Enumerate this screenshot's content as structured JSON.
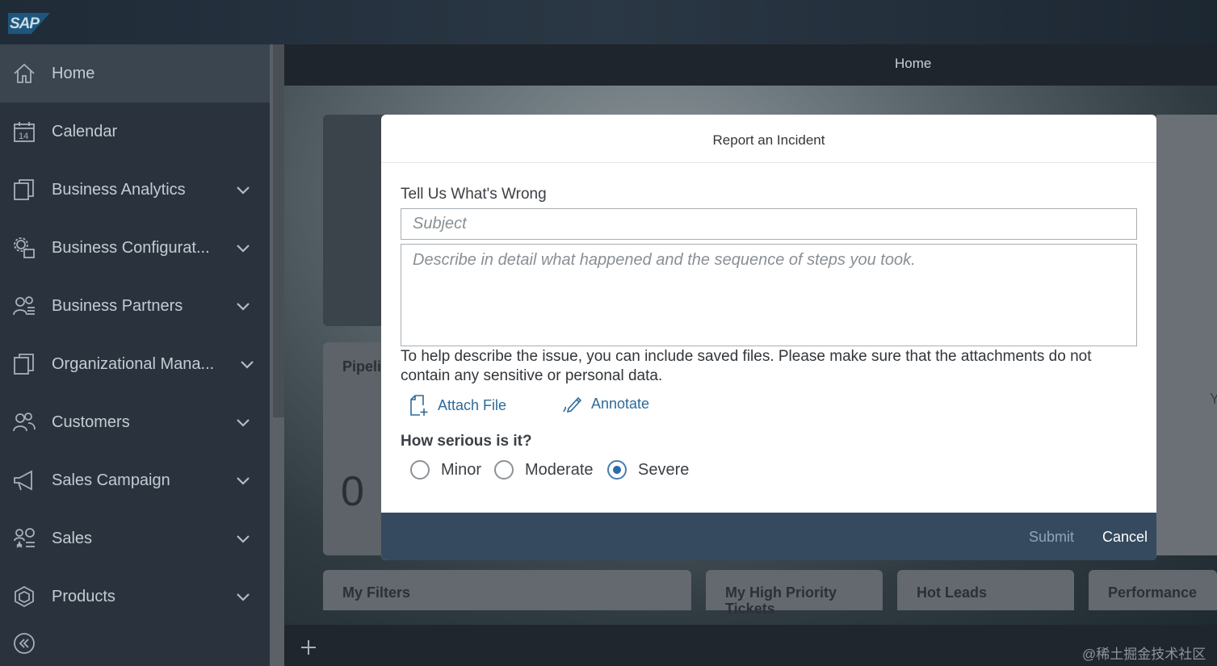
{
  "app": {
    "logo_text": "SAP",
    "shell_title": "Home"
  },
  "sidebar": {
    "items": [
      {
        "label": "Home",
        "icon": "home-icon",
        "active": true,
        "expandable": false
      },
      {
        "label": "Calendar",
        "icon": "calendar-icon",
        "expandable": false
      },
      {
        "label": "Business Analytics",
        "icon": "copy-icon",
        "expandable": true
      },
      {
        "label": "Business Configurat...",
        "icon": "settings-group-icon",
        "expandable": true
      },
      {
        "label": "Business Partners",
        "icon": "partners-icon",
        "expandable": true
      },
      {
        "label": "Organizational Mana...",
        "icon": "copy-icon",
        "expandable": true
      },
      {
        "label": "Customers",
        "icon": "customers-icon",
        "expandable": true
      },
      {
        "label": "Sales Campaign",
        "icon": "megaphone-icon",
        "expandable": true
      },
      {
        "label": "Sales",
        "icon": "sales-icon",
        "expandable": true
      },
      {
        "label": "Products",
        "icon": "product-icon",
        "expandable": true
      }
    ],
    "calendar_day": "14"
  },
  "background": {
    "pipeline_title": "Pipeli",
    "pipeline_value": "0",
    "right_fragment": "Y",
    "tiles": [
      "My Filters",
      "My High Priority Tickets",
      "Hot Leads",
      "Performance"
    ]
  },
  "dialog": {
    "title": "Report an Incident",
    "field_label": "Tell Us What's Wrong",
    "subject_placeholder": "Subject",
    "description_placeholder": "Describe in detail what happened and the sequence of steps you took.",
    "help_text": "To help describe the issue, you can include saved files. Please make sure that the attachments do not contain any sensitive or personal data.",
    "attach_label": "Attach File",
    "annotate_label": "Annotate",
    "severity_label": "How serious is it?",
    "severity_options": [
      "Minor",
      "Moderate",
      "Severe"
    ],
    "severity_selected": "Severe",
    "submit_label": "Submit",
    "cancel_label": "Cancel"
  },
  "watermark": "@稀土掘金技术社区",
  "colors": {
    "link": "#2d6a9a",
    "footer": "#354a5f",
    "sidebar": "#2a333d",
    "radio_selected": "#2d6aa8"
  }
}
